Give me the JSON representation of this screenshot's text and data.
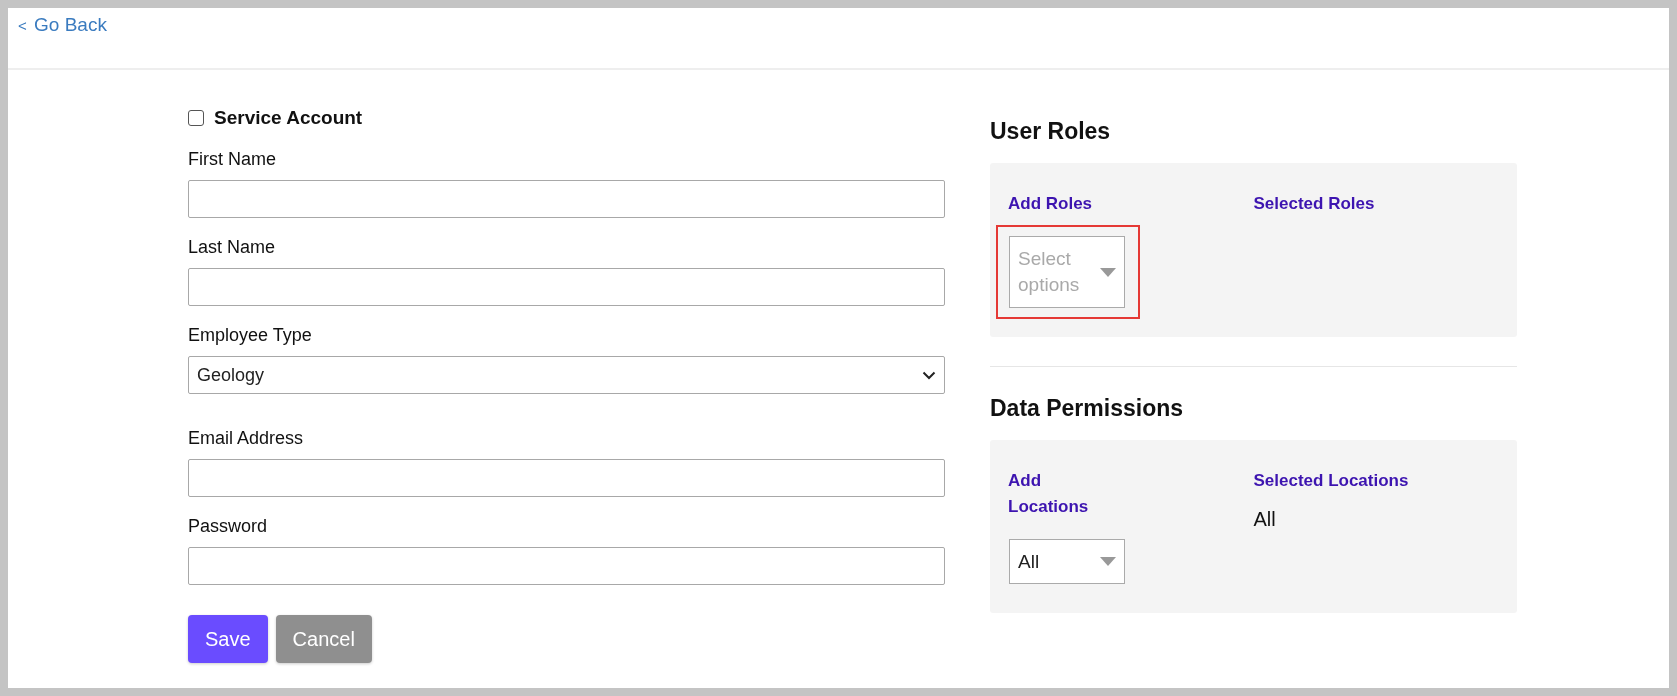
{
  "back_link": {
    "icon": "<",
    "label": "Go Back"
  },
  "form": {
    "service_account": {
      "label": "Service Account",
      "checked": false
    },
    "fields": [
      {
        "kind": "text",
        "label": "First Name"
      },
      {
        "kind": "text",
        "label": "Last Name"
      },
      {
        "kind": "select",
        "label": "Employee Type",
        "value": "Geology"
      },
      {
        "kind": "text",
        "label": "Email Address"
      },
      {
        "kind": "password",
        "label": "Password"
      }
    ],
    "buttons": [
      {
        "label": "Save",
        "disabled": false
      },
      {
        "label": "Cancel",
        "disabled": true
      }
    ]
  },
  "user_roles": {
    "title": "User Roles",
    "add_label": "Add Roles",
    "select": {
      "placeholder": "Select options",
      "highlighted": true
    },
    "selected_label": "Selected Roles"
  },
  "data_permissions": {
    "title": "Data Permissions",
    "add_label": "Add Locations",
    "select": {
      "value": "All"
    },
    "selected_label": "Selected Locations",
    "selected_value": "All"
  }
}
